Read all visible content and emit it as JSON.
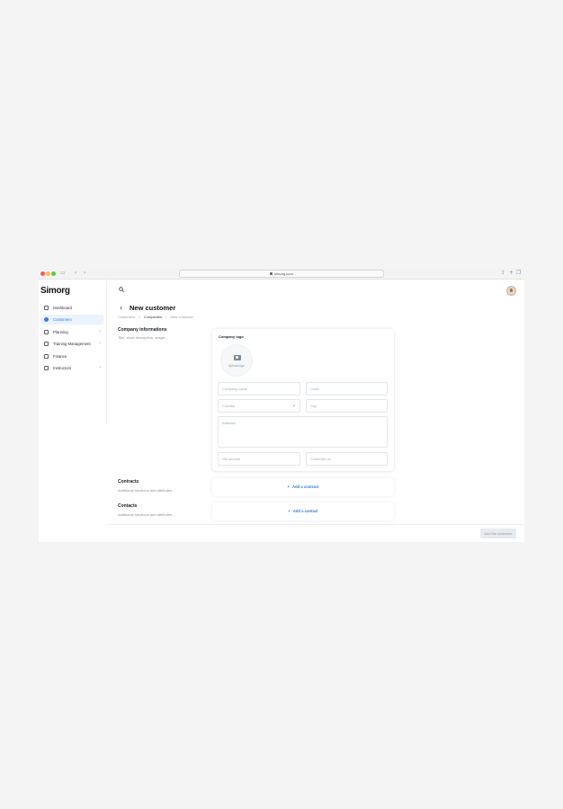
{
  "browser": {
    "url": "simorg.com"
  },
  "app": {
    "logo": "Simorg"
  },
  "sidebar": {
    "items": [
      {
        "label": "Dashboard",
        "icon": "dashboard-icon"
      },
      {
        "label": "Customers",
        "icon": "user-icon",
        "active": true
      },
      {
        "label": "Planning",
        "icon": "calendar-icon",
        "chevron": "›"
      },
      {
        "label": "Training Management",
        "icon": "chart-icon",
        "chevron": "›"
      },
      {
        "label": "Finance",
        "icon": "finance-icon"
      },
      {
        "label": "Instructors",
        "icon": "id-card-icon",
        "chevron": "›"
      }
    ]
  },
  "header": {
    "back_glyph": "‹",
    "title": "New customer",
    "breadcrumb": [
      "Customers",
      "Companies",
      "New customer"
    ],
    "breadcrumb_sep": "•"
  },
  "sections": {
    "company": {
      "title": "Company informations",
      "subtitle": "Title, short description, image..."
    },
    "contracts": {
      "title": "Contracts",
      "subtitle": "Additional functions and attributes..."
    },
    "contacts": {
      "title": "Contacts",
      "subtitle": "Additional functions and attributes..."
    }
  },
  "form": {
    "logo_label": "Company logo",
    "upload_label": "Upload logo",
    "company_name_placeholder": "Company name",
    "code_placeholder": "Code",
    "country_placeholder": "Country",
    "city_placeholder": "City",
    "address_placeholder": "Address",
    "vat_placeholder": "Vat number",
    "customer_no_placeholder": "Customer no"
  },
  "actions": {
    "add_contract": "Add a contract",
    "add_contact": "Add a contact",
    "add_customer": "Add the customer"
  },
  "colors": {
    "accent": "#2f7de1",
    "active_bg": "#eaf3fe"
  }
}
